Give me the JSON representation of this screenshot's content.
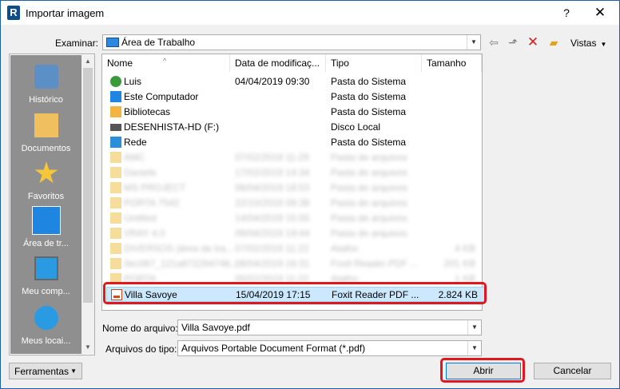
{
  "window": {
    "title": "Importar imagem",
    "app_icon_letter": "R",
    "help_label": "?",
    "close_label": "✕"
  },
  "lookin": {
    "label": "Examinar:",
    "value": "Área de Trabalho",
    "views_label": "Vistas"
  },
  "places": [
    {
      "label": "Histórico",
      "icon": "history-icon"
    },
    {
      "label": "Documentos",
      "icon": "documents-icon"
    },
    {
      "label": "Favoritos",
      "icon": "favorites-icon"
    },
    {
      "label": "Área de tr...",
      "icon": "desktop-icon",
      "selected": true
    },
    {
      "label": "Meu comp...",
      "icon": "computer-icon"
    },
    {
      "label": "Meus locai...",
      "icon": "network-places-icon"
    }
  ],
  "filelist": {
    "headers": {
      "name": "Nome",
      "date": "Data de modificaç...",
      "type": "Tipo",
      "size": "Tamanho"
    },
    "rows": [
      {
        "name": "Luis",
        "date": "04/04/2019 09:30",
        "type": "Pasta do Sistema",
        "size": "",
        "icon": "user-icon"
      },
      {
        "name": "Este Computador",
        "date": "",
        "type": "Pasta do Sistema",
        "size": "",
        "icon": "computer-icon"
      },
      {
        "name": "Bibliotecas",
        "date": "",
        "type": "Pasta do Sistema",
        "size": "",
        "icon": "libraries-icon"
      },
      {
        "name": "DESENHISTA-HD (F:)",
        "date": "",
        "type": "Disco Local",
        "size": "",
        "icon": "drive-icon"
      },
      {
        "name": "Rede",
        "date": "",
        "type": "Pasta do Sistema",
        "size": "",
        "icon": "network-icon"
      },
      {
        "name": "AMC",
        "date": "07/02/2019 11:29",
        "type": "Pasta de arquivos",
        "size": "",
        "icon": "folder-icon"
      },
      {
        "name": "Daniele",
        "date": "17/02/2019 14:34",
        "type": "Pasta de arquivos",
        "size": "",
        "icon": "folder-icon"
      },
      {
        "name": "MS PROJECT",
        "date": "06/04/2019 18:53",
        "type": "Pasta de arquivos",
        "size": "",
        "icon": "folder-icon"
      },
      {
        "name": "PORTA 7542",
        "date": "22/10/2018 09:38",
        "type": "Pasta de arquivos",
        "size": "",
        "icon": "folder-icon"
      },
      {
        "name": "Untitled",
        "date": "14/04/2019 15:55",
        "type": "Pasta de arquivos",
        "size": "",
        "icon": "folder-icon"
      },
      {
        "name": "VRAY 4.0",
        "date": "09/04/2019 19:44",
        "type": "Pasta de arquivos",
        "size": "",
        "icon": "folder-icon"
      },
      {
        "name": "DIVERSOS (área de tra...",
        "date": "07/02/2019 11:22",
        "type": "Atalho",
        "size": "4 KB",
        "icon": "folder-icon"
      },
      {
        "name": "0ec067_121a872294748...",
        "date": "08/04/2019 16:31",
        "type": "Foxit Reader PDF ...",
        "size": "201 KB",
        "icon": "folder-icon"
      },
      {
        "name": "PORTA",
        "date": "05/02/2019 11:22",
        "type": "Atalho",
        "size": "1 KB",
        "icon": "folder-icon"
      }
    ],
    "selected_row": {
      "name": "Villa Savoye",
      "date": "15/04/2019 17:15",
      "type": "Foxit Reader PDF ...",
      "size": "2.824 KB",
      "icon": "pdf-icon"
    }
  },
  "filename": {
    "label": "Nome do arquivo:",
    "value": "Villa Savoye.pdf"
  },
  "filetype": {
    "label": "Arquivos do tipo:",
    "value": "Arquivos Portable Document Format  (*.pdf)"
  },
  "buttons": {
    "tools": "Ferramentas",
    "open": "Abrir",
    "cancel": "Cancelar"
  },
  "colors": {
    "highlight": "#e0171f",
    "selection": "#cce8ff",
    "accent": "#0078d7"
  }
}
